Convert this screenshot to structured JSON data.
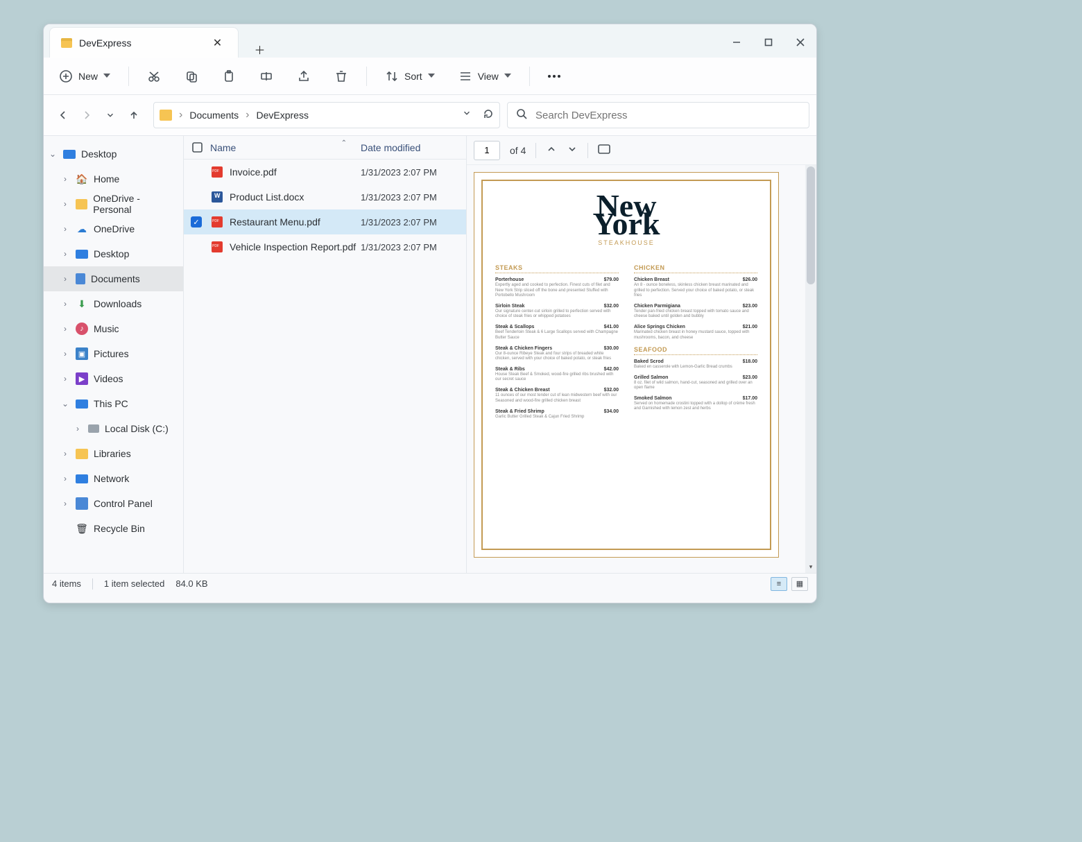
{
  "window": {
    "tab_title": "DevExpress"
  },
  "toolbar": {
    "new": "New",
    "sort": "Sort",
    "view": "View"
  },
  "breadcrumbs": [
    "Documents",
    "DevExpress"
  ],
  "search": {
    "placeholder": "Search DevExpress"
  },
  "tree": {
    "desktop": "Desktop",
    "home": "Home",
    "onedrive_personal": "OneDrive - Personal",
    "onedrive": "OneDrive",
    "desktop2": "Desktop",
    "documents": "Documents",
    "downloads": "Downloads",
    "music": "Music",
    "pictures": "Pictures",
    "videos": "Videos",
    "this_pc": "This PC",
    "local_disk": "Local Disk (C:)",
    "libraries": "Libraries",
    "network": "Network",
    "control_panel": "Control Panel",
    "recycle_bin": "Recycle Bin"
  },
  "list": {
    "head_name": "Name",
    "head_date": "Date modified",
    "rows": [
      {
        "name": "Invoice.pdf",
        "date": "1/31/2023 2:07 PM",
        "type": "pdf",
        "selected": false
      },
      {
        "name": "Product List.docx",
        "date": "1/31/2023 2:07 PM",
        "type": "docx",
        "selected": false
      },
      {
        "name": "Restaurant Menu.pdf",
        "date": "1/31/2023 2:07 PM",
        "type": "pdf",
        "selected": true
      },
      {
        "name": "Vehicle Inspection Report.pdf",
        "date": "1/31/2023 2:07 PM",
        "type": "pdf",
        "selected": false
      }
    ]
  },
  "preview": {
    "page_current": "1",
    "page_total": "of 4",
    "logo_line1": "New",
    "logo_line2": "York",
    "logo_sub": "STEAKHOUSE",
    "left": {
      "section": "STEAKS",
      "items": [
        {
          "name": "Porterhouse",
          "price": "$79.00",
          "desc": "Expertly aged and cooked to perfection. Finest cuts of filet and New York Strip sliced off the bone and presented Stuffed with Portobello Mushroom"
        },
        {
          "name": "Sirloin Steak",
          "price": "$32.00",
          "desc": "Our signature center-cut sirloin grilled to perfection served with choice of steak fries or whipped potatoes"
        },
        {
          "name": "Steak & Scallops",
          "price": "$41.00",
          "desc": "Beef Tenderloin Steak & 6 Large Scallops served with Champagne Butter Sauce"
        },
        {
          "name": "Steak & Chicken Fingers",
          "price": "$30.00",
          "desc": "Our 8-ounce Ribeye Steak and four strips of breaded white chicken, served with your choice of baked potato, or steak fries"
        },
        {
          "name": "Steak & Ribs",
          "price": "$42.00",
          "desc": "House Steak Beef & Smoked, wood-fire grilled ribs brushed with our secret sauce"
        },
        {
          "name": "Steak & Chicken Breast",
          "price": "$32.00",
          "desc": "11 ounces of our most tender cut of lean midwestern beef with our Seasoned and wood-fire grilled chicken breast"
        },
        {
          "name": "Steak & Fried Shrimp",
          "price": "$34.00",
          "desc": "Garlic Butter Grilled Steak & Cajun Fried Shrimp"
        }
      ]
    },
    "right": {
      "section1": "CHICKEN",
      "items1": [
        {
          "name": "Chicken Breast",
          "price": "$26.00",
          "desc": "An 8 - ounce boneless, skinless chicken breast marinated and grilled to perfection. Served your choice of baked potato, or steak fries"
        },
        {
          "name": "Chicken Parmigiana",
          "price": "$23.00",
          "desc": "Tender pan-fried chicken breast topped with tomato sauce and cheese baked until golden and bubbly"
        },
        {
          "name": "Alice Springs Chicken",
          "price": "$21.00",
          "desc": "Marinated chicken breast in honey mustard sauce, topped with mushrooms, bacon, and cheese"
        }
      ],
      "section2": "SEAFOOD",
      "items2": [
        {
          "name": "Baked Scrod",
          "price": "$18.00",
          "desc": "Baked en casserole with Lemon-Garlic Bread crumbs"
        },
        {
          "name": "Grilled Salmon",
          "price": "$23.00",
          "desc": "8 oz. filet of wild salmon, hand-cut, seasoned and grilled over an open flame"
        },
        {
          "name": "Smoked Salmon",
          "price": "$17.00",
          "desc": "Served on homemade crostini topped with a dollop of crème fresh and Garnished with lemon zest and herbs"
        }
      ]
    }
  },
  "status": {
    "items": "4 items",
    "selected": "1 item selected",
    "size": "84.0 KB"
  }
}
